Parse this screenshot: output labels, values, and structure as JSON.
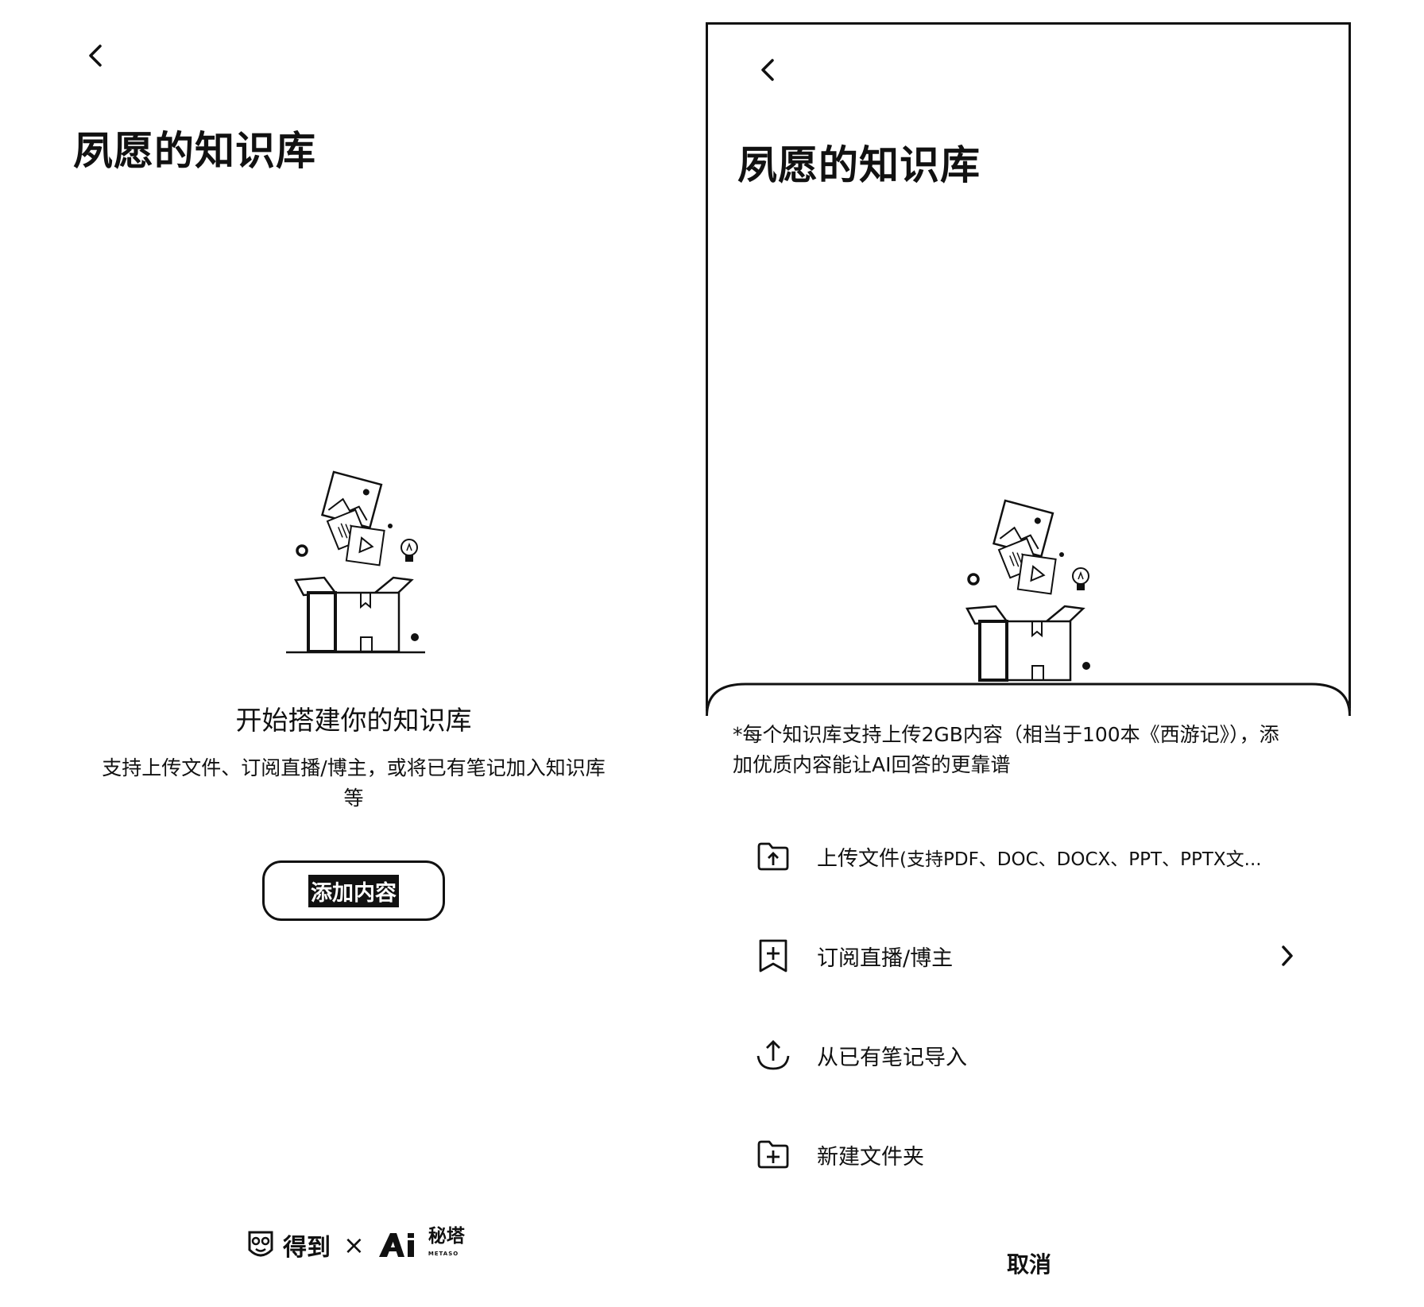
{
  "left_screen": {
    "title": "夙愿的知识库",
    "empty_state": {
      "title": "开始搭建你的知识库",
      "description": "支持上传文件、订阅直播/博主，或将已有笔记加入知识库等",
      "add_button_label": "添加内容"
    },
    "brand": {
      "partner_a": "得到",
      "separator": "×",
      "partner_b": "秘塔",
      "partner_b_sub": "METASO"
    }
  },
  "right_screen": {
    "title": "夙愿的知识库",
    "sheet": {
      "note": "*每个知识库支持上传2GB内容（相当于100本《西游记》），添加优质内容能让AI回答的更靠谱",
      "items": [
        {
          "label": "上传文件",
          "hint": "(支持PDF、DOC、DOCX、PPT、PPTX文...",
          "icon": "upload-folder-icon"
        },
        {
          "label": "订阅直播/博主",
          "icon": "bookmark-add-icon"
        },
        {
          "label": "从已有笔记导入",
          "icon": "import-icon"
        },
        {
          "label": "新建文件夹",
          "icon": "new-folder-icon"
        }
      ],
      "cancel_label": "取消"
    }
  }
}
